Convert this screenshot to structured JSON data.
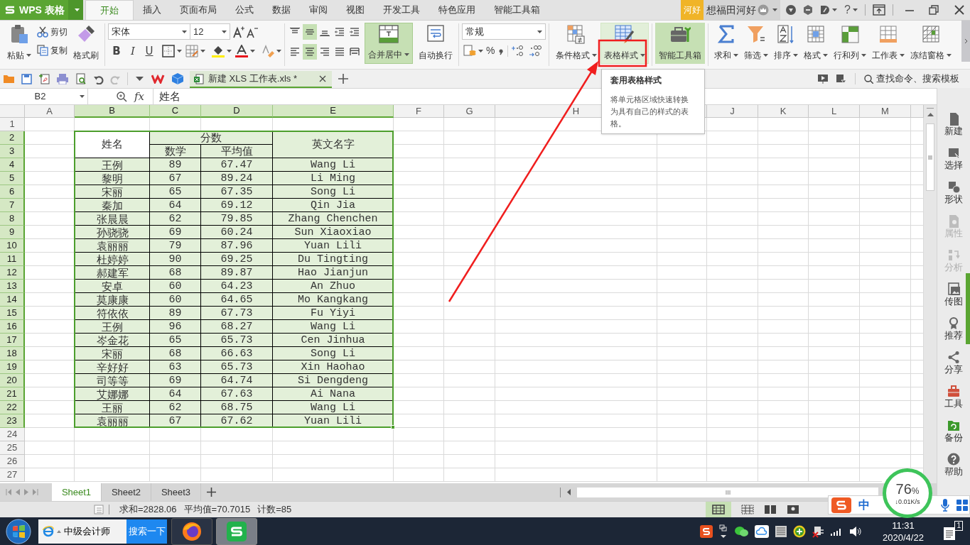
{
  "app_button": {
    "label": "WPS 表格"
  },
  "menu_tabs": [
    {
      "label": "开始",
      "selected": true
    },
    {
      "label": "插入",
      "selected": false
    },
    {
      "label": "页面布局",
      "selected": false
    },
    {
      "label": "公式",
      "selected": false
    },
    {
      "label": "数据",
      "selected": false
    },
    {
      "label": "审阅",
      "selected": false
    },
    {
      "label": "视图",
      "selected": false
    },
    {
      "label": "开发工具",
      "selected": false
    },
    {
      "label": "特色应用",
      "selected": false
    },
    {
      "label": "智能工具箱",
      "selected": false
    }
  ],
  "account": {
    "badge": "河好",
    "user": "想福田河好",
    "help": "?"
  },
  "clipboard": {
    "paste": "粘贴",
    "cut": "剪切",
    "copy": "复制",
    "format_painter": "格式刷"
  },
  "font": {
    "name": "宋体",
    "size": "12",
    "style_buttons": [
      "B",
      "I",
      "U"
    ]
  },
  "align_buttons": [
    {
      "kind": "top",
      "selected": false
    },
    {
      "kind": "middle",
      "selected": true
    },
    {
      "kind": "bottom",
      "selected": false
    },
    {
      "kind": "outdent",
      "selected": false
    },
    {
      "kind": "indent",
      "selected": false
    },
    {
      "kind": "left",
      "selected": false
    },
    {
      "kind": "center",
      "selected": true
    },
    {
      "kind": "right",
      "selected": false
    },
    {
      "kind": "justify",
      "selected": false
    },
    {
      "kind": "distributed",
      "selected": false
    }
  ],
  "merge_button": {
    "label": "合并居中",
    "active": true
  },
  "wrap_button": {
    "label": "自动换行"
  },
  "number": {
    "format": "常规",
    "percent": "%"
  },
  "style_buttons": [
    {
      "kind": "conditional",
      "label": "条件格式",
      "hovered": false,
      "active": false
    },
    {
      "kind": "table",
      "label": "表格样式",
      "hovered": true,
      "active": false
    },
    {
      "kind": "toolbox",
      "label": "智能工具箱",
      "hovered": false,
      "active": true
    }
  ],
  "tool_buttons": [
    {
      "kind": "sum",
      "label": "求和"
    },
    {
      "kind": "filter",
      "label": "筛选"
    },
    {
      "kind": "sort",
      "label": "排序"
    },
    {
      "kind": "format",
      "label": "格式"
    },
    {
      "kind": "rowcol",
      "label": "行和列"
    },
    {
      "kind": "sheet",
      "label": "工作表"
    },
    {
      "kind": "freeze",
      "label": "冻结窗格"
    }
  ],
  "document_tab": {
    "title": "新建 XLS 工作表.xls *"
  },
  "command_search": {
    "placeholder": "查找命令、搜索模板"
  },
  "formula_bar": {
    "cell": "B2",
    "fx": "fx",
    "content": "姓名"
  },
  "columns": [
    {
      "label": "A",
      "selected": false
    },
    {
      "label": "B",
      "selected": true
    },
    {
      "label": "C",
      "selected": true
    },
    {
      "label": "D",
      "selected": true
    },
    {
      "label": "E",
      "selected": true
    },
    {
      "label": "F",
      "selected": false
    },
    {
      "label": "G",
      "selected": false
    },
    {
      "label": "H",
      "selected": false
    },
    {
      "label": "J",
      "selected": false
    },
    {
      "label": "K",
      "selected": false
    },
    {
      "label": "L",
      "selected": false
    },
    {
      "label": "M",
      "selected": false
    }
  ],
  "rows": [
    {
      "label": "1",
      "selected": false
    },
    {
      "label": "2",
      "selected": true
    },
    {
      "label": "3",
      "selected": true
    },
    {
      "label": "4",
      "selected": true
    },
    {
      "label": "5",
      "selected": true
    },
    {
      "label": "6",
      "selected": true
    },
    {
      "label": "7",
      "selected": true
    },
    {
      "label": "8",
      "selected": true
    },
    {
      "label": "9",
      "selected": true
    },
    {
      "label": "10",
      "selected": true
    },
    {
      "label": "11",
      "selected": true
    },
    {
      "label": "12",
      "selected": true
    },
    {
      "label": "13",
      "selected": true
    },
    {
      "label": "14",
      "selected": true
    },
    {
      "label": "15",
      "selected": true
    },
    {
      "label": "16",
      "selected": true
    },
    {
      "label": "17",
      "selected": true
    },
    {
      "label": "18",
      "selected": true
    },
    {
      "label": "19",
      "selected": true
    },
    {
      "label": "20",
      "selected": true
    },
    {
      "label": "21",
      "selected": true
    },
    {
      "label": "22",
      "selected": true
    },
    {
      "label": "23",
      "selected": true
    },
    {
      "label": "24",
      "selected": false
    },
    {
      "label": "25",
      "selected": false
    },
    {
      "label": "26",
      "selected": false
    },
    {
      "label": "27",
      "selected": false
    }
  ],
  "table": {
    "header": [
      {
        "text": "姓名",
        "active": true,
        "rowspan": 2
      },
      {
        "text": "分数",
        "active": false,
        "colspan": 2
      },
      {
        "text": "英文名字",
        "active": false,
        "rowspan": 2
      }
    ],
    "sub_header": [
      "数学",
      "平均值"
    ],
    "rows": [
      [
        "王例",
        "89",
        "67.47",
        "Wang Li"
      ],
      [
        "黎明",
        "67",
        "89.24",
        "Li Ming"
      ],
      [
        "宋丽",
        "65",
        "67.35",
        "Song Li"
      ],
      [
        "秦加",
        "64",
        "69.12",
        "Qin Jia"
      ],
      [
        "张晨晨",
        "62",
        "79.85",
        "Zhang Chenchen"
      ],
      [
        "孙骁骁",
        "69",
        "60.24",
        "Sun Xiaoxiao"
      ],
      [
        "袁丽丽",
        "79",
        "87.96",
        "Yuan Lili"
      ],
      [
        "杜婷婷",
        "90",
        "69.25",
        "Du Tingting"
      ],
      [
        "郝建军",
        "68",
        "89.87",
        "Hao Jianjun"
      ],
      [
        "安卓",
        "60",
        "64.23",
        "An Zhuo"
      ],
      [
        "莫康康",
        "60",
        "64.65",
        "Mo Kangkang"
      ],
      [
        "符依依",
        "89",
        "67.73",
        "Fu Yiyi"
      ],
      [
        "王例",
        "96",
        "68.27",
        "Wang Li"
      ],
      [
        "岑金花",
        "65",
        "65.73",
        "Cen Jinhua"
      ],
      [
        "宋丽",
        "68",
        "66.63",
        "Song Li"
      ],
      [
        "辛好好",
        "63",
        "65.73",
        "Xin Haohao"
      ],
      [
        "司等等",
        "69",
        "64.74",
        "Si Dengdeng"
      ],
      [
        "艾娜娜",
        "64",
        "67.63",
        "Ai Nana"
      ],
      [
        "王丽",
        "62",
        "68.75",
        "Wang Li"
      ],
      [
        "袁丽丽",
        "67",
        "67.62",
        "Yuan Lili"
      ]
    ]
  },
  "tooltip": {
    "title": "套用表格样式",
    "text": "将单元格区域快速转换为具有自己的样式的表格。"
  },
  "sheet_tabs": [
    {
      "label": "Sheet1",
      "selected": true
    },
    {
      "label": "Sheet2",
      "selected": false
    },
    {
      "label": "Sheet3",
      "selected": false
    }
  ],
  "status_bar": [
    "求和=2828.06",
    "平均值=70.7015",
    "计数=85"
  ],
  "side_panel": [
    {
      "kind": "new",
      "label": "新建",
      "disabled": false
    },
    {
      "kind": "select",
      "label": "选择",
      "disabled": false
    },
    {
      "kind": "shape",
      "label": "形状",
      "disabled": false
    },
    {
      "kind": "property",
      "label": "属性",
      "disabled": true
    },
    {
      "kind": "analyze",
      "label": "分析",
      "disabled": true
    },
    {
      "kind": "image",
      "label": "传图",
      "disabled": false
    },
    {
      "kind": "recommend",
      "label": "推荐",
      "disabled": false
    },
    {
      "kind": "share",
      "label": "分享",
      "disabled": false
    },
    {
      "kind": "tools",
      "label": "工具",
      "disabled": false
    },
    {
      "kind": "backup",
      "label": "备份",
      "disabled": false
    },
    {
      "kind": "help",
      "label": "帮助",
      "disabled": false
    }
  ],
  "speed_widget": {
    "percent": "76",
    "unit": "%",
    "rate": "↓0.01K/s"
  },
  "input_method": {
    "mode": "中"
  },
  "taskbar": {
    "search_value": "中级会计师",
    "search_button": "搜索一下",
    "time": "11:31",
    "date": "2020/4/22",
    "notifications": "1"
  }
}
